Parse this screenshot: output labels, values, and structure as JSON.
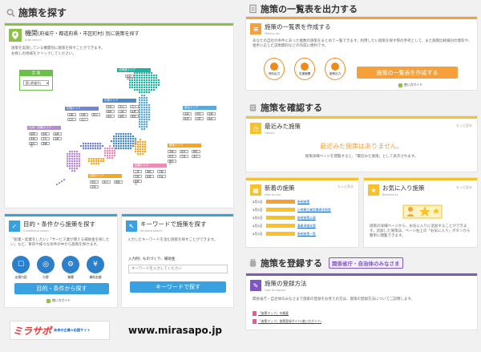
{
  "left": {
    "section_title": "施策を探す",
    "map_card": {
      "title": "機関",
      "title_suffix": "(府省庁・都道府県・市区町村) 別に施策を探す",
      "sub": "Area search",
      "desc1": "施策を実施している機関別に施策を探すことができます。",
      "desc2": "お探しの地域をクリックしてください。",
      "national_label": "全 国",
      "national_select": "国 (府省庁)",
      "regions": [
        {
          "name": "北海道エリア",
          "color": "#22b3a0"
        },
        {
          "name": "東北エリア",
          "color": "#5aa7d8"
        },
        {
          "name": "中部エリア",
          "color": "#4a8bcf"
        },
        {
          "name": "関東エリア",
          "color": "#f5a623"
        },
        {
          "name": "近畿エリア",
          "color": "#e98fb5"
        },
        {
          "name": "中国エリア",
          "color": "#6f85d6"
        },
        {
          "name": "九州・沖縄エリア",
          "color": "#b68bd8"
        },
        {
          "name": "四国エリア",
          "color": "#f5a623"
        }
      ],
      "hokkaido_prefs": [
        "北海道"
      ],
      "tohoku_prefs": [
        "青森",
        "岩手",
        "宮城",
        "秋田",
        "山形",
        "福島"
      ],
      "chubu_prefs": [
        "新潟",
        "富山",
        "石川",
        "福井",
        "山梨",
        "長野",
        "岐阜",
        "静岡",
        "愛知"
      ],
      "kanto_prefs": [
        "茨城",
        "栃木",
        "群馬",
        "埼玉",
        "千葉",
        "東京",
        "神奈川"
      ],
      "kinki_prefs": [
        "三重",
        "滋賀",
        "京都",
        "大阪",
        "兵庫",
        "奈良",
        "和歌山"
      ],
      "chugoku_prefs": [
        "鳥取",
        "島根",
        "岡山",
        "広島",
        "山口"
      ],
      "kyushu_prefs": [
        "福岡",
        "佐賀",
        "長崎",
        "熊本",
        "大分",
        "宮崎",
        "鹿児島",
        "沖縄"
      ],
      "shikoku_prefs": [
        "徳島",
        "香川",
        "愛媛",
        "高知"
      ]
    },
    "purpose_card": {
      "title": "目的・条件から施策を探す",
      "sub": "Conditional search",
      "desc": "「創業・起業をしたい」「サービス業が使える補助金を探したい」など、目的や様々な条件の中から施策を探せます。",
      "icons": [
        {
          "label": "支援内容",
          "color": "#2c7fc9"
        },
        {
          "label": "分野",
          "color": "#2c7fc9"
        },
        {
          "label": "業種",
          "color": "#2c7fc9"
        },
        {
          "label": "補助金額",
          "color": "#2c7fc9"
        }
      ],
      "button": "目的・条件から探す",
      "guide": "使い方ガイド"
    },
    "keyword_card": {
      "title": "キーワードで施策を探す",
      "sub": "Keyword search",
      "desc": "入力したキーワードを含む施策を探すことができます。",
      "input_label": "入力例）ものづくり、補助金",
      "input_placeholder": "キーワードを入力してください",
      "button": "キーワードで探す"
    },
    "logo_text": "ミラサポ",
    "logo_tagline": "未来の企業★応援サイト",
    "site_url": "www.mirasapo.jp"
  },
  "right": {
    "list_section_title": "施策の一覧表を出力する",
    "list_card": {
      "title": "施策の一覧表を作成する",
      "sub": "Making list",
      "desc": "あなたの自社の条件にあった複数の施策をまとめて一覧できます。利用したい施策を探す際の参考として、また施策比較検討の資料や、相手に応じた説明資料などの作成に便利です。",
      "icons": [
        {
          "label": "資料出力",
          "color": "#f08a1c"
        },
        {
          "label": "支援機関",
          "color": "#f08a1c"
        },
        {
          "label": "施策出力",
          "color": "#f08a1c"
        }
      ],
      "button": "施策の一覧表を作成する",
      "guide": "使い方ガイド"
    },
    "confirm_section_title": "施策を確認する",
    "recent_card": {
      "title": "最近みた施策",
      "sub": "History",
      "more": "もっと見る",
      "empty": "最近みた施策はありません。",
      "desc": "施策詳細ページを閲覧すると、「最近みた施策」として表示されます。"
    },
    "new_card": {
      "title": "新着の施策",
      "sub": "New Arrival",
      "more": "もっと見る",
      "items": [
        {
          "date": "4月1日",
          "tag": "",
          "text": "新規施策"
        },
        {
          "date": "4月1日",
          "tag": "",
          "text": "小規模企業設備資金制度"
        },
        {
          "date": "4月1日",
          "tag": "",
          "text": "新規施策公募"
        },
        {
          "date": "4月1日",
          "tag": "",
          "text": "事業承継支援"
        },
        {
          "date": "4月1日",
          "tag": "",
          "text": "新規施策一覧"
        }
      ]
    },
    "fav_card": {
      "title": "お気に入り施策",
      "sub": "Bookmarks",
      "more": "もっと見る",
      "desc": "施策の詳細ページから、お気に入りに追加することができます。追加した施策は、ページ右上の「お気に入り」ボタンから簡単に閲覧できます。"
    },
    "register_section_title": "施策を登録する",
    "register_tag": "関係省庁・自治体のみなさま",
    "register_card": {
      "title": "施策の登録方法",
      "sub": "How to register",
      "desc": "関係省庁・自治体のみなさまで施策の登録をお考えの方は、施策の登録方法についてご説明します。",
      "link1": "「施策マップ」の概要",
      "link2": "「施策マップ」施策登録ガイド(使い方ガイド)"
    }
  },
  "colors": {
    "green": "#8bc34a",
    "blue": "#3aa1e0",
    "orange": "#f6a03a",
    "yellow": "#f6c12a",
    "purple": "#7e57c2",
    "pink": "#e95a9a"
  }
}
